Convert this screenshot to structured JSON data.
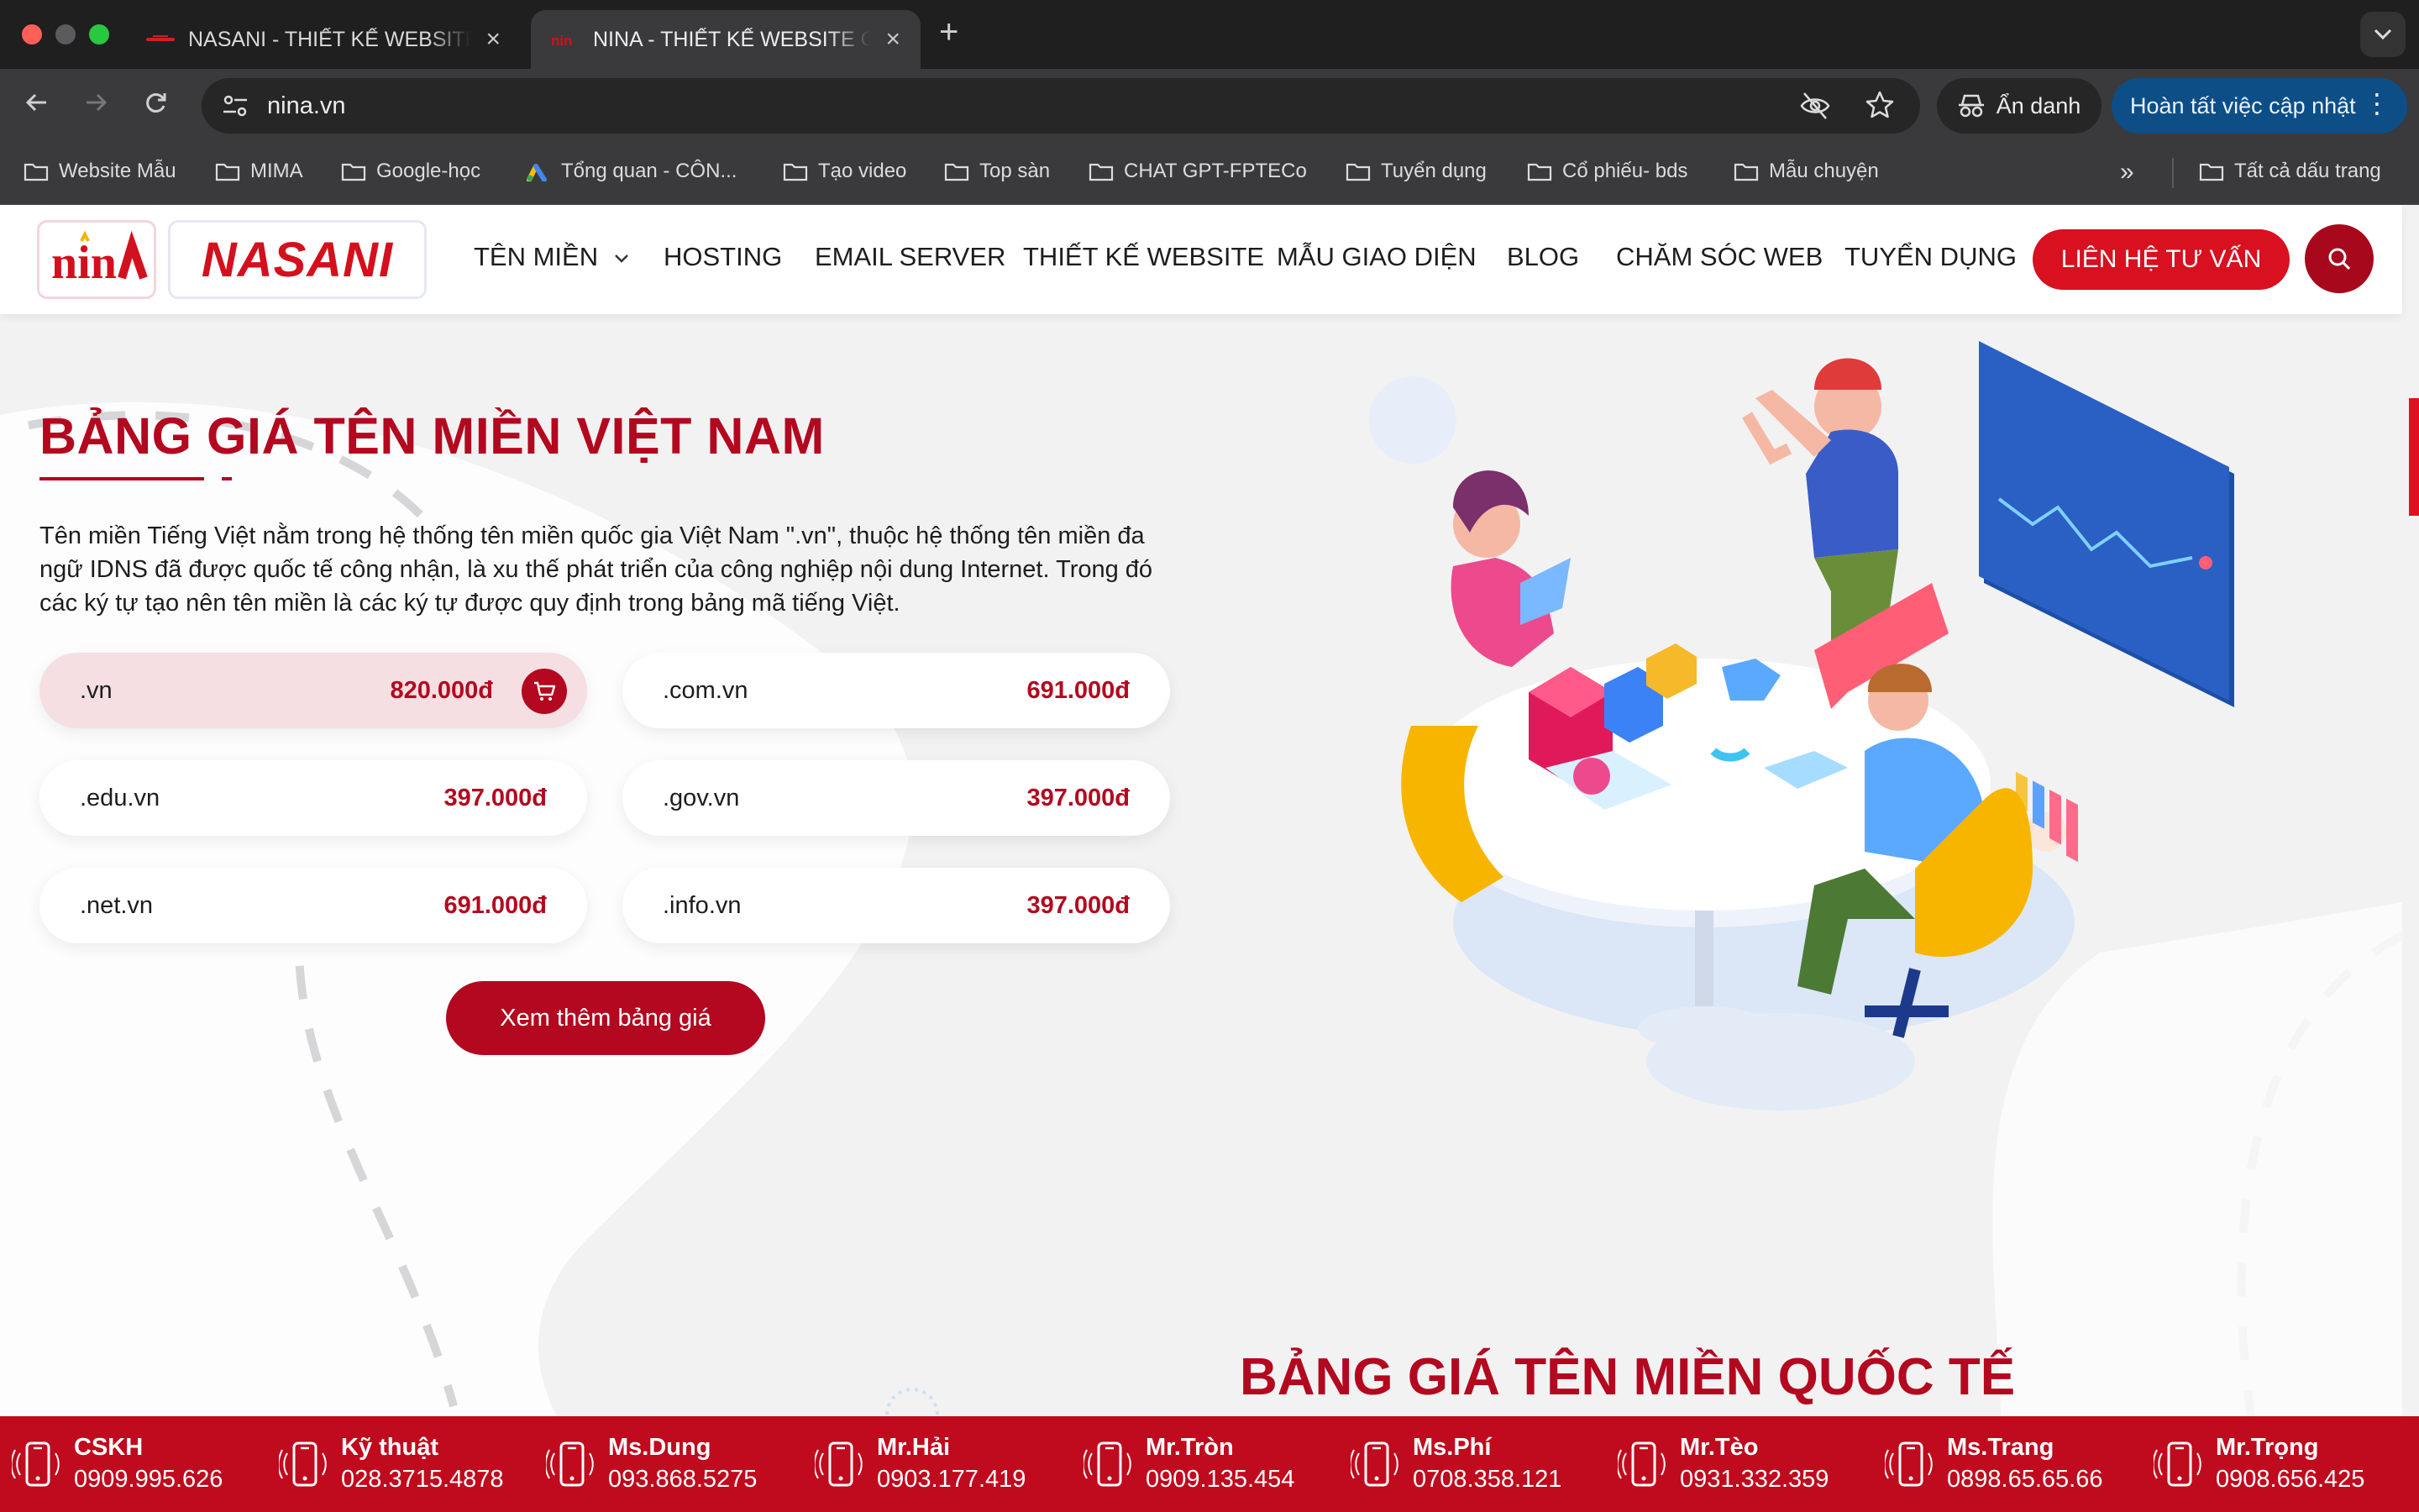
{
  "browser": {
    "tabs": [
      {
        "title": "NASANI - THIẾT KẾ WEBSITE CHUYÊN NGHIỆP",
        "active": false
      },
      {
        "title": "NINA - THIẾT KẾ WEBSITE CHUYÊN NGHIỆP",
        "active": true
      }
    ],
    "url": "nina.vn",
    "incognito_label": "Ẩn danh",
    "update_label": "Hoàn tất việc cập nhật",
    "bookmarks": [
      "Website Mẫu",
      "MIMA",
      "Google-học",
      "Tổng quan - CÔN...",
      "Tạo video",
      "Top sàn",
      "CHAT GPT-FPTECo",
      "Tuyển dụng",
      "Cổ phiếu- bds",
      "Mẫu chuyện"
    ],
    "all_bookmarks": "Tất cả dấu trang"
  },
  "site": {
    "logo_text": "NASANI",
    "logo_mark": "nina",
    "nav": [
      {
        "label": "TÊN MIỀN",
        "dropdown": true
      },
      {
        "label": "HOSTING"
      },
      {
        "label": "EMAIL SERVER"
      },
      {
        "label": "THIẾT KẾ WEBSITE"
      },
      {
        "label": "MẪU GIAO DIỆN"
      },
      {
        "label": "BLOG"
      },
      {
        "label": "CHĂM SÓC WEB"
      },
      {
        "label": "TUYỂN DỤNG"
      }
    ],
    "contact_button": "LIÊN HỆ TƯ VẤN",
    "vn_section": {
      "title": "BẢNG GIÁ TÊN MIỀN VIỆT NAM",
      "description": "Tên miền Tiếng Việt nằm trong hệ thống tên miền quốc gia Việt Nam \".vn\", thuộc hệ thống tên miền đa ngữ IDNS đã được quốc tế công nhận, là xu thế phát triển của công nghiệp nội dung Internet. Trong đó các ký tự tạo nên tên miền là các ký tự được quy định trong bảng mã tiếng Việt.",
      "prices": [
        {
          "domain": ".vn",
          "price": "820.000đ"
        },
        {
          "domain": ".com.vn",
          "price": "691.000đ"
        },
        {
          "domain": ".edu.vn",
          "price": "397.000đ"
        },
        {
          "domain": ".gov.vn",
          "price": "397.000đ"
        },
        {
          "domain": ".net.vn",
          "price": "691.000đ"
        },
        {
          "domain": ".info.vn",
          "price": "397.000đ"
        }
      ],
      "more_button": "Xem thêm bảng giá"
    },
    "intl_section": {
      "title": "BẢNG GIÁ TÊN MIỀN QUỐC TẾ"
    },
    "hotlines": [
      {
        "name": "CSKH",
        "phone": "0909.995.626"
      },
      {
        "name": "Kỹ thuật",
        "phone": "028.3715.4878"
      },
      {
        "name": "Ms.Dung",
        "phone": "093.868.5275"
      },
      {
        "name": "Mr.Hải",
        "phone": "0903.177.419"
      },
      {
        "name": "Mr.Tròn",
        "phone": "0909.135.454"
      },
      {
        "name": "Ms.Phí",
        "phone": "0708.358.121"
      },
      {
        "name": "Mr.Tèo",
        "phone": "0931.332.359"
      },
      {
        "name": "Ms.Trang",
        "phone": "0898.65.65.66"
      },
      {
        "name": "Mr.Trọng",
        "phone": "0908.656.425"
      }
    ],
    "colors": {
      "brand_red": "#b3081f",
      "hotbar_red": "#c00a1e"
    }
  }
}
